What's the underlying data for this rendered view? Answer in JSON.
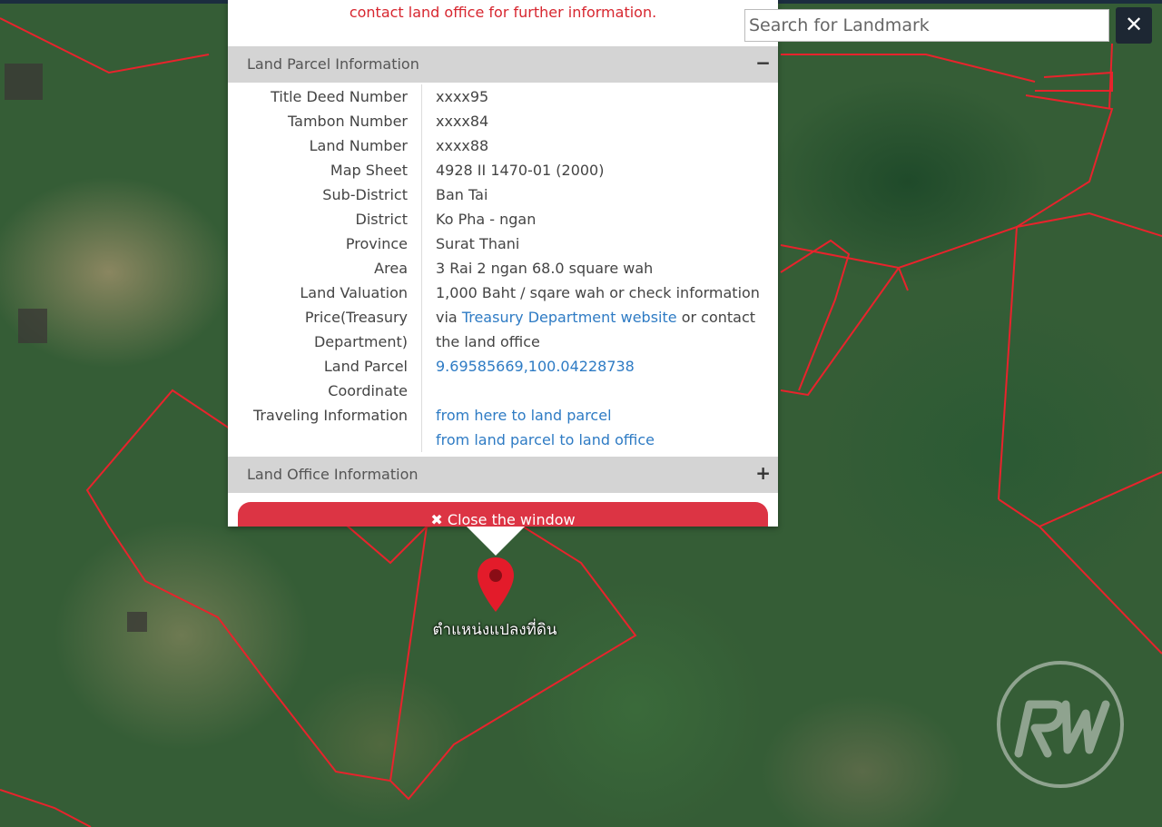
{
  "popup": {
    "notice": "contact land office for further information.",
    "parcel_section_title": "Land Parcel Information",
    "parcel_section_toggle": "−",
    "office_section_title": "Land Office Information",
    "office_section_toggle": "+",
    "rows": {
      "title_deed": {
        "label": "Title Deed Number",
        "value": "xxxx95"
      },
      "tambon": {
        "label": "Tambon Number",
        "value": "xxxx84"
      },
      "land_number": {
        "label": "Land Number",
        "value": "xxxx88"
      },
      "map_sheet": {
        "label": "Map Sheet",
        "value": "4928 II 1470-01 (2000)"
      },
      "sub_district": {
        "label": "Sub-District",
        "value": "Ban Tai"
      },
      "district": {
        "label": "District",
        "value": "Ko Pha - ngan"
      },
      "province": {
        "label": "Province",
        "value": "Surat Thani"
      },
      "area": {
        "label": "Area",
        "value": "3 Rai 2 ngan 68.0 square wah"
      },
      "valuation": {
        "label_line1": "Land Valuation",
        "label_line2": "Price(Treasury",
        "label_line3": "Department)",
        "value_line1": "1,000 Baht / sqare wah or check information",
        "value_prefix": "via ",
        "value_link": "Treasury Department website",
        "value_suffix": " or contact",
        "value_line3": "the land office"
      },
      "coordinate": {
        "label_line1": "Land Parcel",
        "label_line2": "Coordinate",
        "value": "9.69585669,100.04228738"
      },
      "traveling": {
        "label": "Traveling Information",
        "link1": "from here to land parcel",
        "link2": "from land parcel to land office"
      }
    },
    "close_button_icon": "✖",
    "close_button_label": "Close the window"
  },
  "search": {
    "placeholder": "Search for Landmark",
    "value": "",
    "close_icon": "✕"
  },
  "marker": {
    "label": "ตำแหน่งแปลงที่ดิน",
    "color": "#e31b2a"
  },
  "colors": {
    "accent_red": "#dc3444",
    "link_blue": "#2e7bc4",
    "parcel_line": "#e8232c"
  }
}
